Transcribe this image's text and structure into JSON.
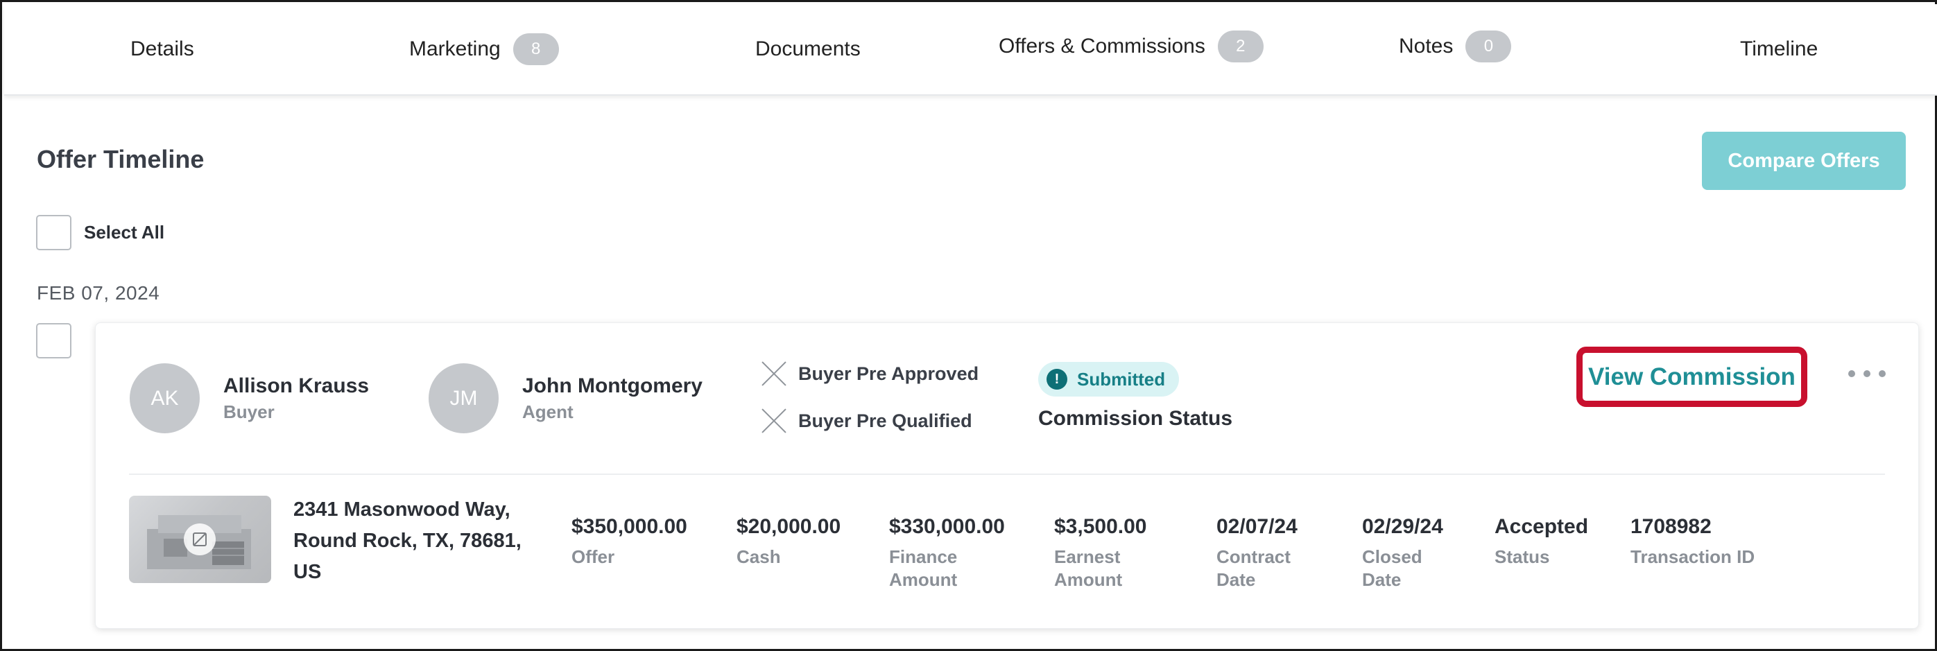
{
  "tabs": [
    {
      "label": "Details"
    },
    {
      "label": "Marketing",
      "badge": "8"
    },
    {
      "label": "Documents"
    },
    {
      "label": "Offers & Commissions",
      "badge": "2"
    },
    {
      "label": "Notes",
      "badge": "0"
    },
    {
      "label": "Timeline"
    }
  ],
  "page": {
    "title": "Offer Timeline",
    "compare_button": "Compare Offers",
    "select_all": "Select All",
    "date_group": "FEB 07, 2024"
  },
  "offer": {
    "buyer": {
      "initials": "AK",
      "name": "Allison Krauss",
      "role": "Buyer"
    },
    "agent": {
      "initials": "JM",
      "name": "John Montgomery",
      "role": "Agent"
    },
    "checks": [
      {
        "label": "Buyer Pre Approved",
        "icon": "x-icon"
      },
      {
        "label": "Buyer Pre Qualified",
        "icon": "x-icon"
      }
    ],
    "status_pill": {
      "label": "Submitted",
      "icon": "!"
    },
    "commission_status_label": "Commission Status",
    "view_commission": "View Commission",
    "more_icon": "ellipsis-icon",
    "address_lines": [
      "2341 Masonwood Way,",
      "Round Rock, TX, 78681,",
      "US"
    ],
    "metrics": [
      {
        "value": "$350,000.00",
        "label_lines": [
          "Offer"
        ]
      },
      {
        "value": "$20,000.00",
        "label_lines": [
          "Cash"
        ]
      },
      {
        "value": "$330,000.00",
        "label_lines": [
          "Finance",
          "Amount"
        ]
      },
      {
        "value": "$3,500.00",
        "label_lines": [
          "Earnest",
          "Amount"
        ]
      },
      {
        "value": "02/07/24",
        "label_lines": [
          "Contract",
          "Date"
        ]
      },
      {
        "value": "02/29/24",
        "label_lines": [
          "Closed",
          "Date"
        ]
      },
      {
        "value": "Accepted",
        "label_lines": [
          "Status"
        ]
      },
      {
        "value": "1708982",
        "label_lines": [
          "Transaction ID"
        ]
      }
    ]
  },
  "colors": {
    "accent": "#1f8f96",
    "compare_button_bg": "#7dcfd4",
    "highlight_border": "#c8102e",
    "badge_bg": "#c5c8cc"
  }
}
